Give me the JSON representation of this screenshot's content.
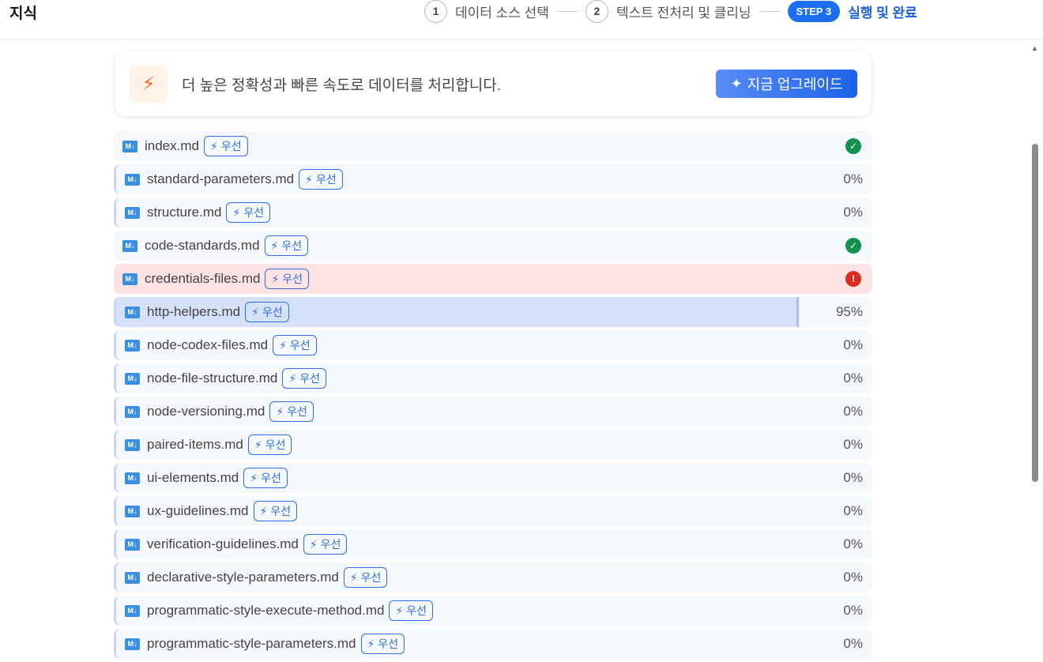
{
  "header": {
    "title": "지식",
    "steps": [
      {
        "num": "1",
        "label": "데이터 소스 선택"
      },
      {
        "num": "2",
        "label": "텍스트 전처리 및 클리닝"
      },
      {
        "num": "STEP 3",
        "label": "실행 및 완료"
      }
    ]
  },
  "banner": {
    "icon": "lightning-fast-icon",
    "text": "더 높은 정확성과 빠른 속도로 데이터를 처리합니다.",
    "button": "지금 업그레이드"
  },
  "badge_label": "우선",
  "files": [
    {
      "name": "index.md",
      "status": "done"
    },
    {
      "name": "standard-parameters.md",
      "status": "0%",
      "progress": 0
    },
    {
      "name": "structure.md",
      "status": "0%",
      "progress": 0
    },
    {
      "name": "code-standards.md",
      "status": "done"
    },
    {
      "name": "credentials-files.md",
      "status": "error"
    },
    {
      "name": "http-helpers.md",
      "status": "95%",
      "progress": 95
    },
    {
      "name": "node-codex-files.md",
      "status": "0%",
      "progress": 0
    },
    {
      "name": "node-file-structure.md",
      "status": "0%",
      "progress": 0
    },
    {
      "name": "node-versioning.md",
      "status": "0%",
      "progress": 0
    },
    {
      "name": "paired-items.md",
      "status": "0%",
      "progress": 0
    },
    {
      "name": "ui-elements.md",
      "status": "0%",
      "progress": 0
    },
    {
      "name": "ux-guidelines.md",
      "status": "0%",
      "progress": 0
    },
    {
      "name": "verification-guidelines.md",
      "status": "0%",
      "progress": 0
    },
    {
      "name": "declarative-style-parameters.md",
      "status": "0%",
      "progress": 0
    },
    {
      "name": "programmatic-style-execute-method.md",
      "status": "0%",
      "progress": 0
    },
    {
      "name": "programmatic-style-parameters.md",
      "status": "0%",
      "progress": 0
    }
  ],
  "colors": {
    "accent": "#1d6ff2",
    "success": "#15904f",
    "error": "#d92b20",
    "error_bg": "#fde3e3",
    "progress_fill": "#d5e1f9"
  }
}
